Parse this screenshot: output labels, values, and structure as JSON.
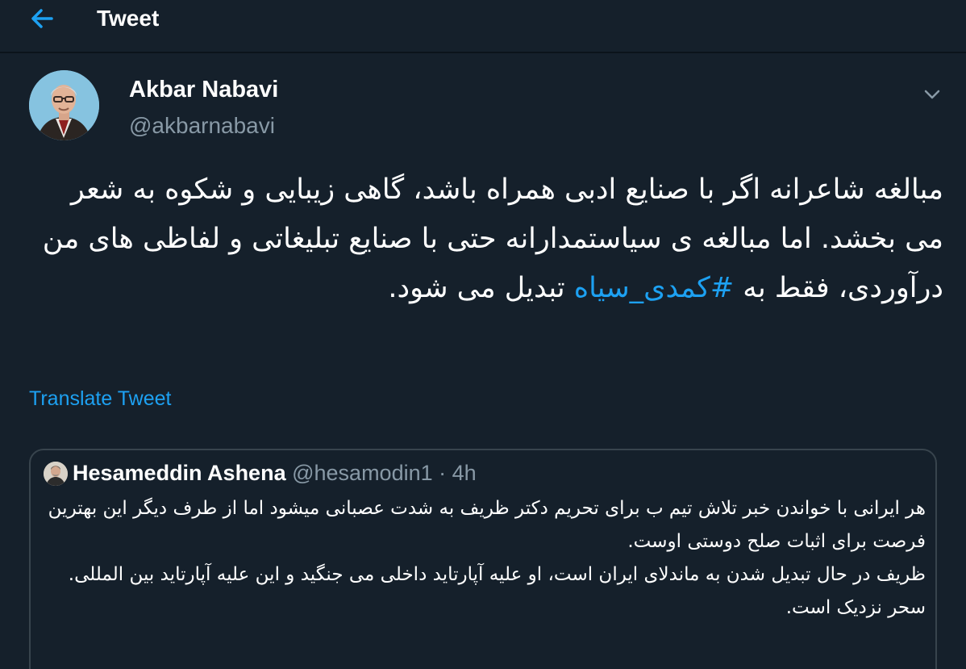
{
  "header": {
    "title": "Tweet",
    "back_icon": "arrow-left-icon",
    "accent_color": "#1da1f2"
  },
  "tweet": {
    "author_name": "Akbar Nabavi",
    "author_handle": "@akbarnabavi",
    "text_before_hashtag": "مبالغه شاعرانه اگر با صنایع ادبی همراه باشد، گاهی زیبایی و شکوه به شعر می بخشد. اما مبالغه ی سیاستمدارانه حتی با صنایع تبلیغاتی و لفاظی های من درآوردی، فقط به ",
    "hashtag": "#کمدی_سیاه",
    "text_after_hashtag": " تبدیل می شود.",
    "translate_label": "Translate Tweet"
  },
  "quoted_tweet": {
    "author_name": "Hesameddin Ashena",
    "author_handle": "@hesamodin1",
    "separator": "·",
    "time": "4h",
    "lines": [
      "هر ایرانی با خواندن خبر تلاش تیم ب برای تحریم دکتر ظریف به شدت عصبانی میشود اما از طرف دیگر این بهترین فرصت برای اثبات صلح دوستی اوست.",
      "ظریف در حال تبدیل شدن به ماندلای ایران است، او علیه آپارتاید داخلی می جنگید و این علیه آپارتاید بین المللی.",
      "سحر نزدیک است."
    ]
  },
  "colors": {
    "background": "#15202b",
    "secondary_text": "#8899a6",
    "border": "#38444d",
    "link": "#1da1f2"
  }
}
